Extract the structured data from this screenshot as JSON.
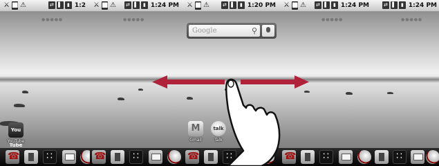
{
  "screens": [
    {
      "time": "1:2",
      "apps": [
        {
          "label": "YouTube",
          "glyph": "You Tube",
          "icon": "youtube-icon"
        }
      ]
    },
    {
      "time": "1:24 PM",
      "apps": []
    },
    {
      "time": "1:20 PM",
      "apps": [
        {
          "label": "Gmail",
          "glyph": "",
          "icon": "gmail-icon"
        },
        {
          "label": "Talk",
          "glyph": "talk",
          "icon": "talk-icon"
        }
      ]
    },
    {
      "time": "1:24 PM",
      "apps": []
    },
    {
      "time": "1:24 PM",
      "apps": []
    }
  ],
  "search_widget": {
    "logo": "Google"
  },
  "status_icons": [
    "usb-icon",
    "sd-card-icon",
    "warning-icon"
  ],
  "status_right_icons": [
    "sync-icon",
    "signal-icon",
    "battery-icon"
  ],
  "dock_items": [
    "phone-icon",
    "contacts-icon",
    "app-drawer-icon",
    "messaging-icon",
    "browser-icon"
  ],
  "colors": {
    "arrow": "#b0213a",
    "status_bar": "#dcdcdc",
    "dock": "#111111"
  }
}
